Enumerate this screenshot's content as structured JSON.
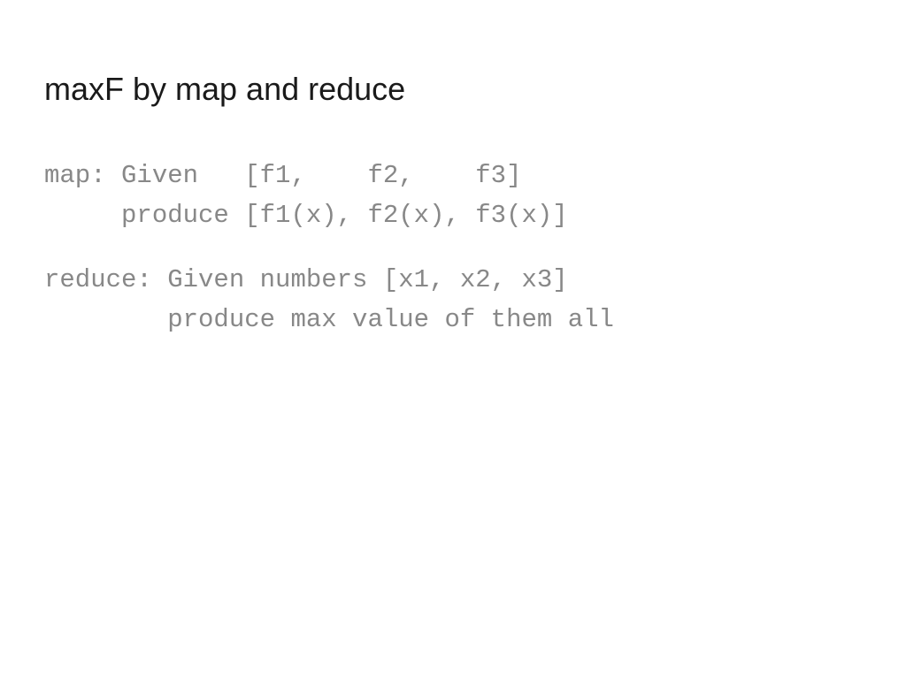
{
  "slide": {
    "title": "maxF by map and reduce",
    "map_line1": "map: Given   [f1,    f2,    f3]",
    "map_line2": "     produce [f1(x), f2(x), f3(x)]",
    "reduce_line1": "reduce: Given numbers [x1, x2, x3]",
    "reduce_line2": "        produce max value of them all"
  }
}
